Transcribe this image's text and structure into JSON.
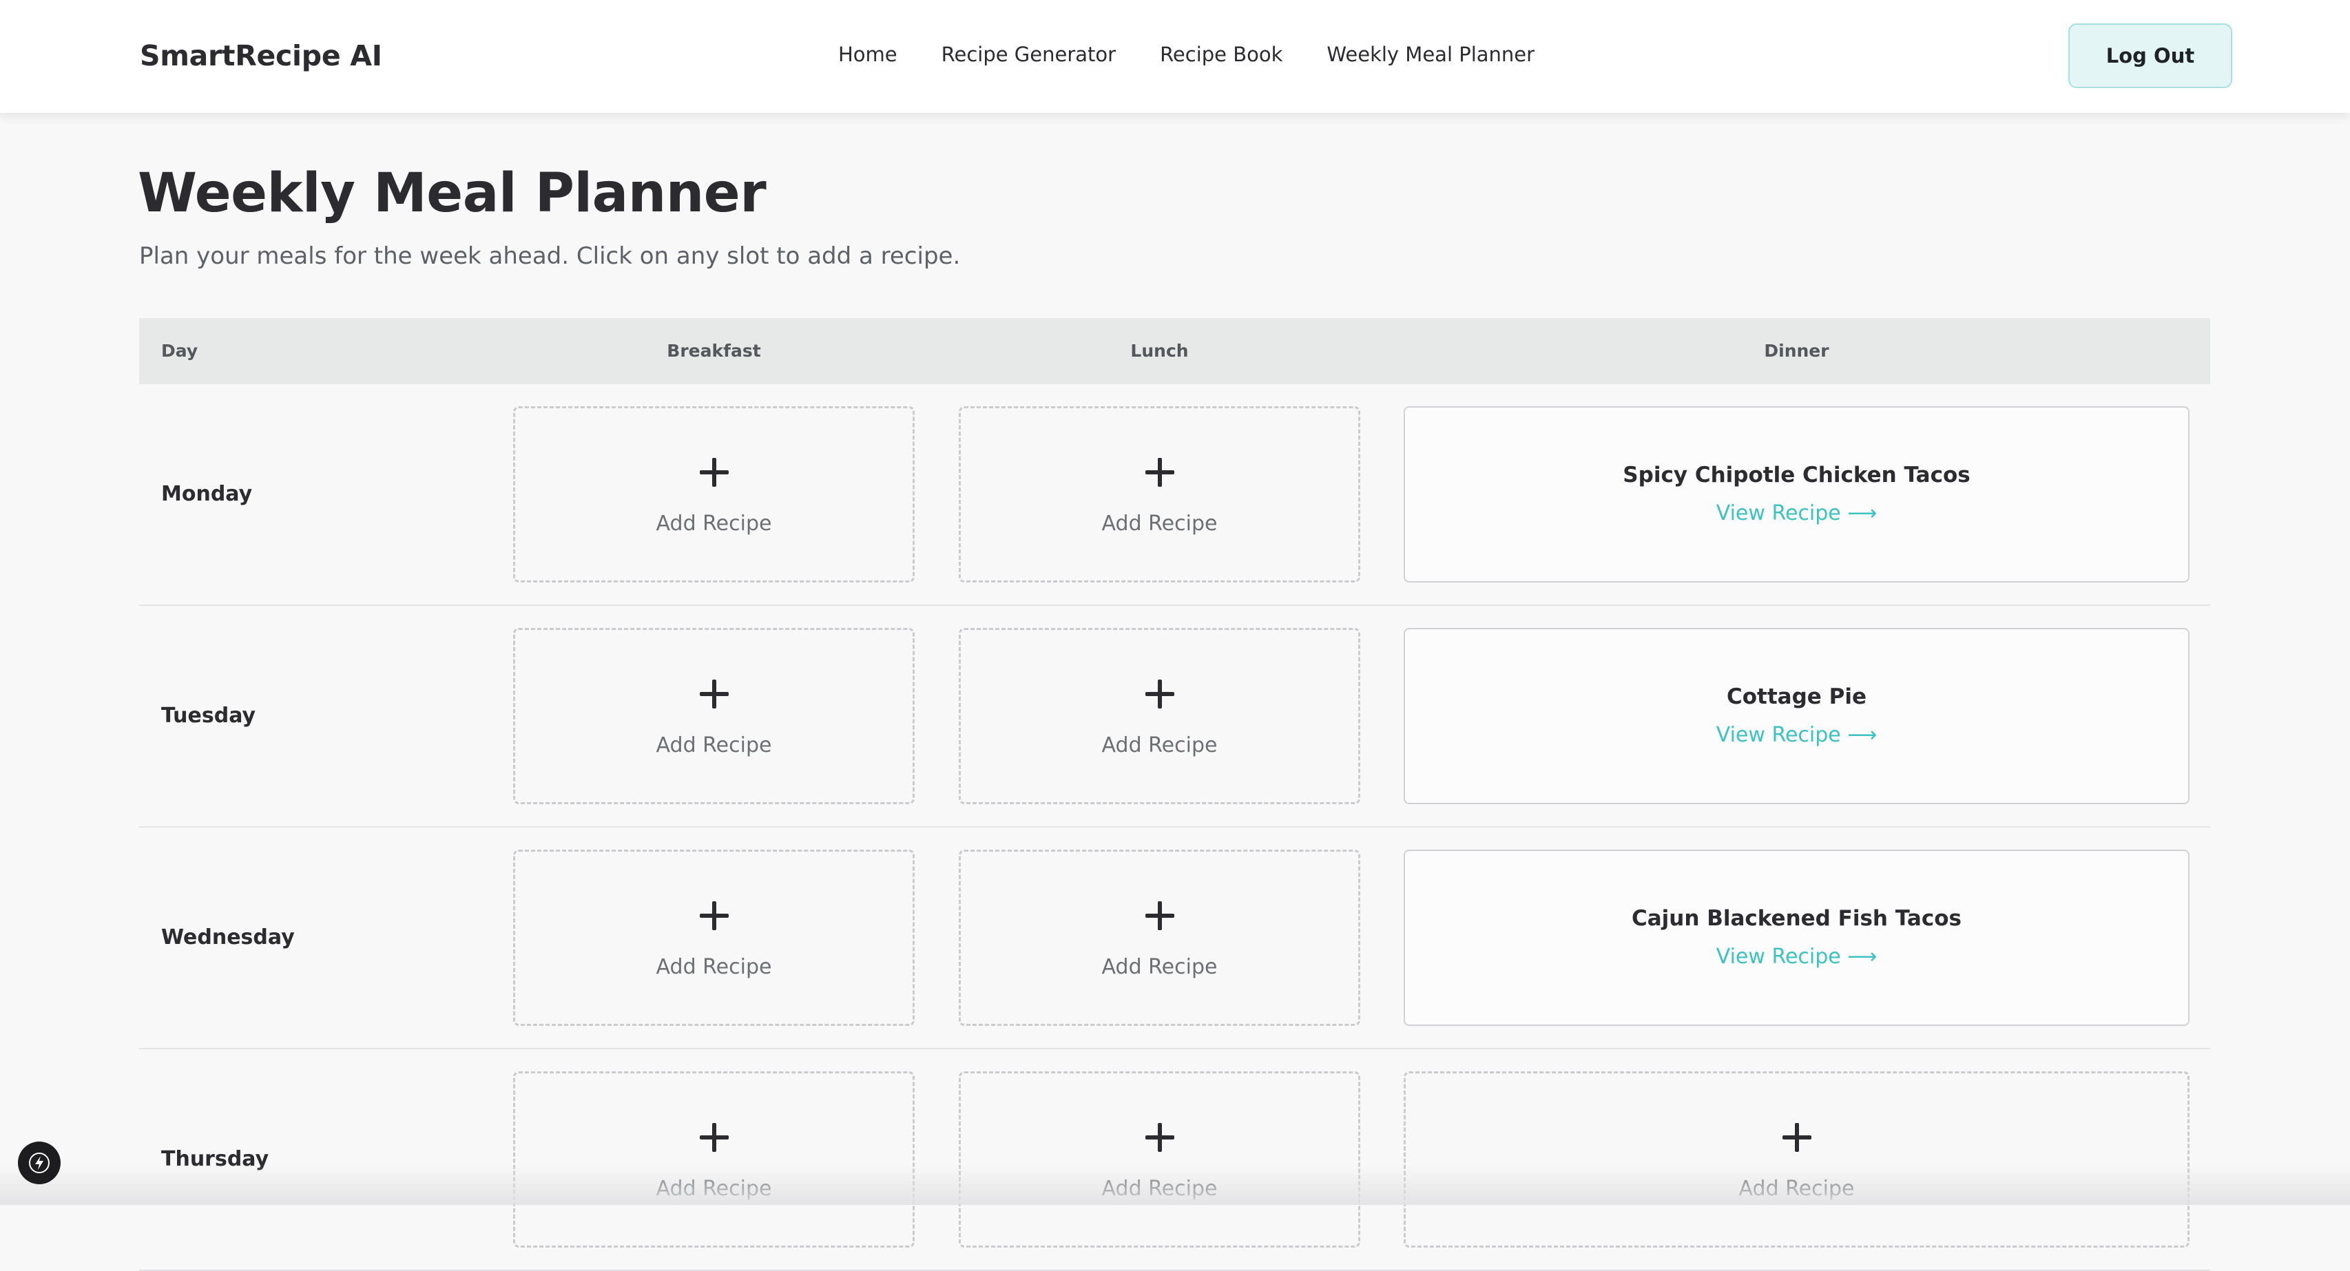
{
  "header": {
    "brand": "SmartRecipe AI",
    "nav": [
      "Home",
      "Recipe Generator",
      "Recipe Book",
      "Weekly Meal Planner"
    ],
    "logout_label": "Log Out"
  },
  "main": {
    "title": "Weekly Meal Planner",
    "subtitle": "Plan your meals for the week ahead. Click on any slot to add a recipe.",
    "columns": [
      "Day",
      "Breakfast",
      "Lunch",
      "Dinner"
    ],
    "add_label": "Add Recipe",
    "view_label": "View Recipe ⟶",
    "rows": [
      {
        "day": "Monday",
        "breakfast": null,
        "lunch": null,
        "dinner": "Spicy Chipotle Chicken Tacos"
      },
      {
        "day": "Tuesday",
        "breakfast": null,
        "lunch": null,
        "dinner": "Cottage Pie"
      },
      {
        "day": "Wednesday",
        "breakfast": null,
        "lunch": null,
        "dinner": "Cajun Blackened Fish Tacos"
      },
      {
        "day": "Thursday",
        "breakfast": null,
        "lunch": null,
        "dinner": null
      }
    ]
  },
  "colors": {
    "accent": "#3cc2c2",
    "logout_bg": "#e3f5f5",
    "table_header_bg": "#e7e8e8"
  },
  "icons": {
    "add": "plus-icon",
    "dev_tools": "lightning-icon"
  }
}
